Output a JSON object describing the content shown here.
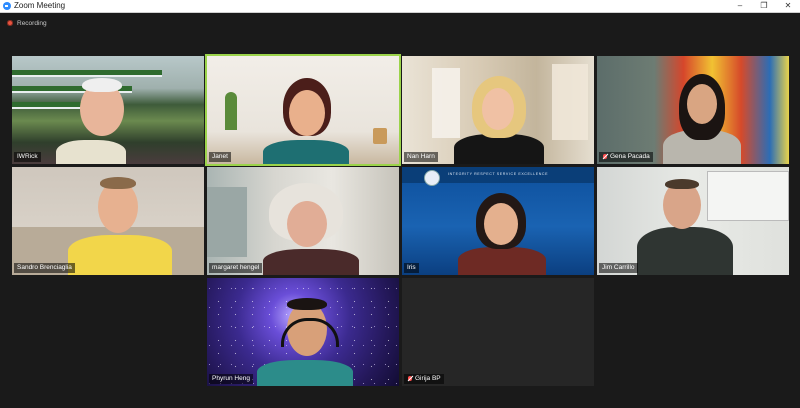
{
  "window": {
    "title": "Zoom Meeting",
    "controls": [
      "–",
      "❐",
      "✕"
    ]
  },
  "recording": {
    "label": "Recording",
    "color": "#e8533f"
  },
  "active_speaker_color": "#9bd34a",
  "participants": [
    {
      "name": "IWRick",
      "muted": false,
      "active": false
    },
    {
      "name": "Janet",
      "muted": false,
      "active": true
    },
    {
      "name": "Nan Harn",
      "muted": false,
      "active": false
    },
    {
      "name": "Gena Pacada",
      "muted": true,
      "active": false
    },
    {
      "name": "Sandro Brenciaglia",
      "muted": false,
      "active": false
    },
    {
      "name": "margaret hengel",
      "muted": false,
      "active": false
    },
    {
      "name": "Iris",
      "muted": false,
      "active": false
    },
    {
      "name": "Jim Carrillo",
      "muted": false,
      "active": false
    },
    {
      "name": "Phyrun Heng",
      "muted": false,
      "active": false
    },
    {
      "name": "Girija BP",
      "muted": true,
      "active": false
    }
  ],
  "iris_background": {
    "banner_text": "INTEGRITY   RESPECT   SERVICE   EXCELLENCE"
  }
}
